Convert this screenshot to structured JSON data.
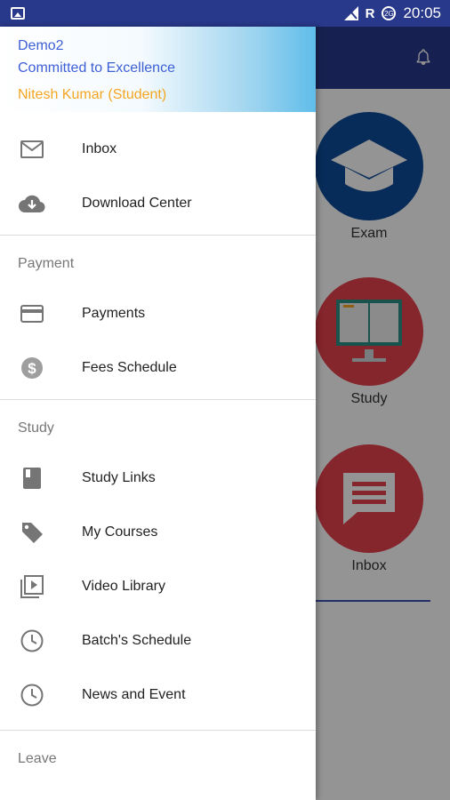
{
  "status_bar": {
    "time": "20:05",
    "network": "R",
    "data_saver": "2G"
  },
  "background_app": {
    "tiles": [
      {
        "label": "Exam",
        "icon": "graduation-cap-icon",
        "color": "#0f4c9a"
      },
      {
        "label": "Study",
        "icon": "book-monitor-icon",
        "color": "#e5414d"
      },
      {
        "label": "Inbox",
        "icon": "chat-bubble-icon",
        "color": "#e5414d"
      }
    ]
  },
  "drawer": {
    "institute_name": "Demo2",
    "tagline": "Committed to Excellence",
    "user": "Nitesh Kumar (Student)",
    "top_items": [
      {
        "label": "Inbox",
        "icon": "mail-icon"
      },
      {
        "label": "Download Center",
        "icon": "cloud-download-icon"
      }
    ],
    "payment_section": "Payment",
    "payment_items": [
      {
        "label": "Payments",
        "icon": "credit-card-icon"
      },
      {
        "label": "Fees Schedule",
        "icon": "dollar-circle-icon"
      }
    ],
    "study_section": "Study",
    "study_items": [
      {
        "label": "Study Links",
        "icon": "book-icon"
      },
      {
        "label": "My Courses",
        "icon": "tag-icon"
      },
      {
        "label": "Video Library",
        "icon": "video-library-icon"
      },
      {
        "label": "Batch's Schedule",
        "icon": "clock-icon"
      },
      {
        "label": "News and Event",
        "icon": "clock-icon"
      }
    ],
    "leave_section": "Leave"
  }
}
